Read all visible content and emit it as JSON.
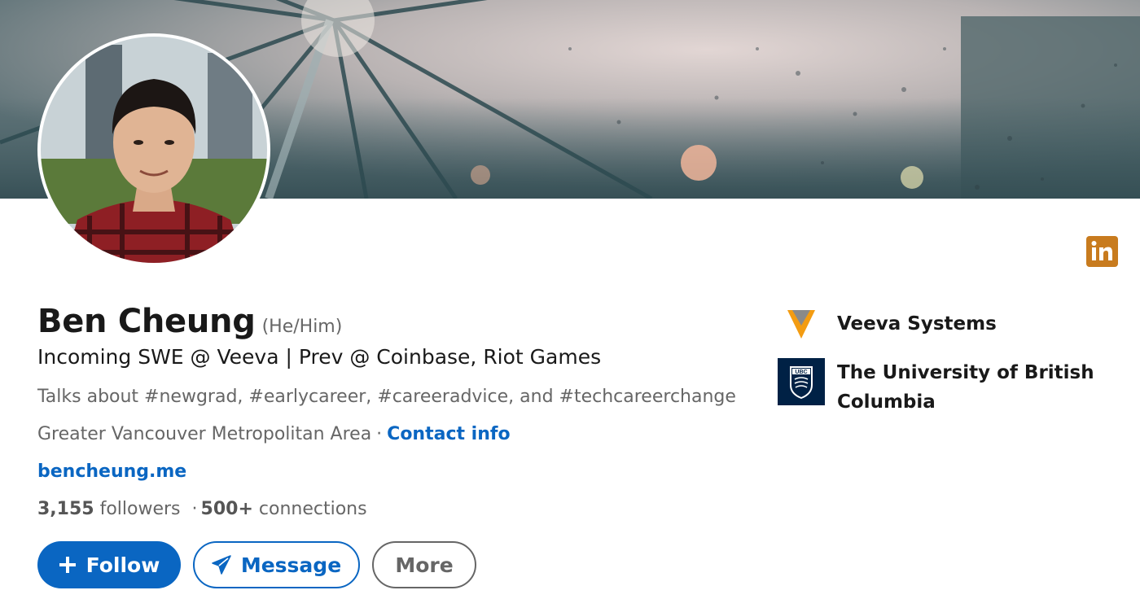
{
  "profile": {
    "name": "Ben Cheung",
    "pronouns": "(He/Him)",
    "headline": "Incoming SWE @ Veeva | Prev @ Coinbase, Riot Games",
    "talks_about": "Talks about #newgrad, #earlycareer, #careeradvice, and #techcareerchange",
    "location": "Greater Vancouver Metropolitan Area",
    "location_separator": "·",
    "contact_info_label": "Contact info",
    "website": "bencheung.me",
    "followers_count": "3,155",
    "followers_label": "followers",
    "stats_separator": "·",
    "connections_count": "500+",
    "connections_label": "connections"
  },
  "actions": {
    "follow_label": "Follow",
    "message_label": "Message",
    "more_label": "More"
  },
  "organizations": [
    {
      "name": "Veeva Systems",
      "logo": "veeva-logo"
    },
    {
      "name": "The University of British Columbia",
      "logo": "ubc-logo"
    }
  ],
  "ubc_logo_text": "UBC",
  "icons": {
    "follow": "plus-icon",
    "message": "paper-plane-icon",
    "badge": "linkedin-icon"
  },
  "colors": {
    "brand_blue": "#0a66c2",
    "linkedin_badge": "#c87b1e",
    "veeva_orange": "#f39c12",
    "ubc_navy": "#002145"
  }
}
